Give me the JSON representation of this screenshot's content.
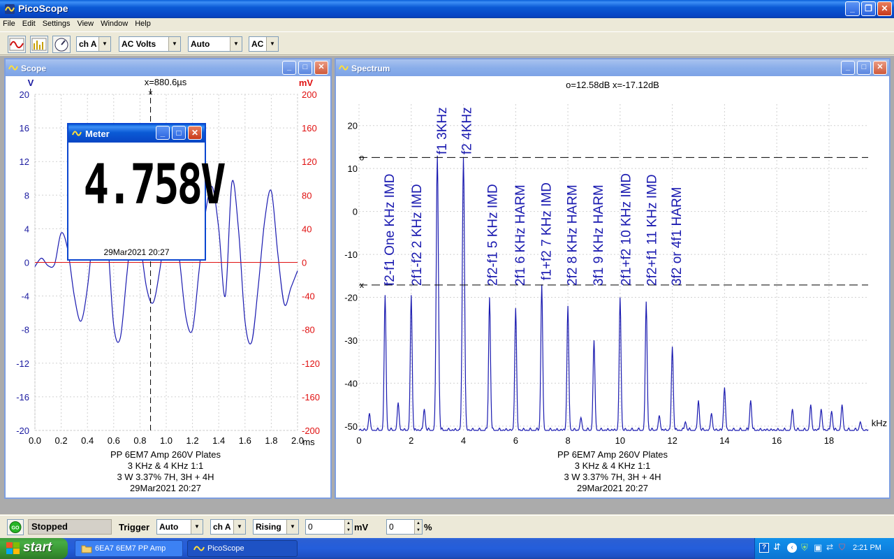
{
  "window": {
    "title": "PicoScope"
  },
  "menu": [
    "File",
    "Edit",
    "Settings",
    "View",
    "Window",
    "Help"
  ],
  "toolbar": {
    "channel": "ch A",
    "units": "AC Volts",
    "range": "Auto",
    "coupling": "AC"
  },
  "scope": {
    "title": "Scope",
    "left_unit": "V",
    "right_unit": "mV",
    "cursor_readout": "x=880.6µs",
    "y_left_ticks": [
      "20",
      "16",
      "12",
      "8",
      "4",
      "0",
      "-4",
      "-8",
      "-12",
      "-16",
      "-20"
    ],
    "y_right_ticks": [
      "200",
      "160",
      "120",
      "80",
      "40",
      "0",
      "-40",
      "-80",
      "-120",
      "-160",
      "-200"
    ],
    "x_ticks": [
      "0.0",
      "0.2",
      "0.4",
      "0.6",
      "0.8",
      "1.0",
      "1.2",
      "1.4",
      "1.6",
      "1.8",
      "2.0"
    ],
    "x_unit": "ms",
    "notes": [
      "PP 6EM7 Amp 260V Plates",
      "3 KHz & 4 KHz 1:1",
      "3 W 3.37% 7H, 3H + 4H",
      "29Mar2021  20:27"
    ]
  },
  "meter": {
    "title": "Meter",
    "reading": "4.758V",
    "date": "29Mar2021  20:27"
  },
  "spectrum": {
    "title": "Spectrum",
    "cursor_readout": "o=12.58dB  x=-17.12dB",
    "y_ticks": [
      "20",
      "10",
      "0",
      "-10",
      "-20",
      "-30",
      "-40",
      "-50"
    ],
    "x_ticks": [
      "0",
      "2",
      "4",
      "6",
      "8",
      "10",
      "12",
      "14",
      "16",
      "18"
    ],
    "x_unit": "kHz",
    "o_marker": "o",
    "x_marker": "x",
    "annotations": [
      "f2-f1 One KHz IMD",
      "2f1-f2  2 KHz IMD",
      "f1  3KHz",
      "f2  4KHz",
      "2f2-f1  5 KHz IMD",
      "2f1 6 KHz HARM",
      "f1+f2  7 KHz IMD",
      "2f2 8 KHz HARM",
      "3f1 9 KHz HARM",
      "2f1+f2 10 KHz IMD",
      "2f2+f1 11 KHz IMD",
      "3f2 or 4f1 HARM"
    ],
    "notes": [
      "PP 6EM7 Amp 260V Plates",
      "3 KHz & 4 KHz 1:1",
      "3 W 3.37% 7H, 3H + 4H",
      "29Mar2021  20:27"
    ]
  },
  "chart_data": [
    {
      "type": "line",
      "xlabel": "ms",
      "ylabel": "V",
      "xlim": [
        0,
        2.0
      ],
      "ylim": [
        -20,
        20
      ],
      "x": [
        0.0,
        0.05,
        0.1,
        0.15,
        0.2,
        0.25,
        0.3,
        0.35,
        0.4,
        0.45,
        0.5,
        0.55,
        0.6,
        0.65,
        0.7,
        0.75,
        0.8,
        0.85,
        0.9,
        0.95,
        1.0,
        1.05,
        1.1,
        1.15,
        1.2,
        1.25,
        1.3,
        1.35,
        1.4,
        1.45,
        1.5,
        1.55,
        1.6,
        1.65,
        1.7,
        1.75,
        1.8,
        1.85,
        1.9,
        1.95,
        2.0
      ],
      "series": [
        {
          "name": "ch A",
          "values": [
            -0.5,
            0.5,
            -0.4,
            -0.2,
            3.5,
            1.5,
            -4.0,
            -7.0,
            -3.0,
            4.5,
            9.5,
            3.5,
            -7.5,
            -9.0,
            -1.5,
            5.5,
            2.5,
            -3.0,
            -4.8,
            -1.0,
            4.5,
            6.5,
            0.5,
            -6.5,
            -8.0,
            -1.0,
            6.0,
            9.0,
            4.0,
            -4.0,
            9.5,
            4.0,
            -7.0,
            -9.5,
            -3.0,
            5.0,
            8.5,
            1.0,
            -5.0,
            -3.0,
            -1.0
          ]
        },
        {
          "name": "ch A (mV)",
          "values": [
            0,
            0,
            0,
            0,
            0,
            0,
            0,
            0,
            0,
            0,
            0,
            0,
            0,
            0,
            0,
            0,
            0,
            0,
            0,
            0,
            0,
            0,
            0,
            0,
            0,
            0,
            0,
            0,
            0,
            0,
            0,
            0,
            0,
            0,
            0,
            0,
            0,
            0,
            0,
            0,
            0
          ]
        }
      ]
    },
    {
      "type": "line",
      "xlabel": "kHz",
      "ylabel": "dB",
      "xlim": [
        0,
        19.5
      ],
      "ylim": [
        -51,
        25
      ],
      "peaks": [
        {
          "x": 1,
          "y": -19.5
        },
        {
          "x": 2,
          "y": -19.5
        },
        {
          "x": 3,
          "y": 13.0
        },
        {
          "x": 4,
          "y": 12.5
        },
        {
          "x": 5,
          "y": -20.0
        },
        {
          "x": 6,
          "y": -22.5
        },
        {
          "x": 7,
          "y": -17.0
        },
        {
          "x": 8,
          "y": -22.0
        },
        {
          "x": 9,
          "y": -30.0
        },
        {
          "x": 10,
          "y": -20.0
        },
        {
          "x": 11,
          "y": -21.0
        },
        {
          "x": 12,
          "y": -31.5
        },
        {
          "x": 13,
          "y": -44.0
        },
        {
          "x": 14,
          "y": -41.0
        },
        {
          "x": 15,
          "y": -44.0
        },
        {
          "x": 1.5,
          "y": -44.5
        },
        {
          "x": 2.5,
          "y": -46.0
        },
        {
          "x": 0.4,
          "y": -47.0
        },
        {
          "x": 16.6,
          "y": -46.0
        },
        {
          "x": 17.3,
          "y": -45.0
        },
        {
          "x": 17.7,
          "y": -46.0
        },
        {
          "x": 18.1,
          "y": -46.5
        },
        {
          "x": 18.5,
          "y": -45.0
        },
        {
          "x": 19.2,
          "y": -49.0
        },
        {
          "x": 11.5,
          "y": -47.5
        },
        {
          "x": 12.5,
          "y": -49.0
        },
        {
          "x": 13.5,
          "y": -47.0
        },
        {
          "x": 8.5,
          "y": -48.0
        }
      ],
      "noise_floor": -51,
      "cursors": {
        "o": 12.58,
        "x": -17.12
      }
    }
  ],
  "statusbar": {
    "run_button": "GO",
    "status": "Stopped",
    "trigger_label": "Trigger",
    "trigger_mode": "Auto",
    "trigger_channel": "ch A",
    "trigger_edge": "Rising",
    "threshold": "0",
    "threshold_unit": "mV",
    "delay": "0",
    "delay_unit": "%"
  },
  "taskbar": {
    "start": "start",
    "tasks": [
      "6EA7 6EM7 PP Amp",
      "PicoScope"
    ],
    "clock": "2:21 PM"
  }
}
